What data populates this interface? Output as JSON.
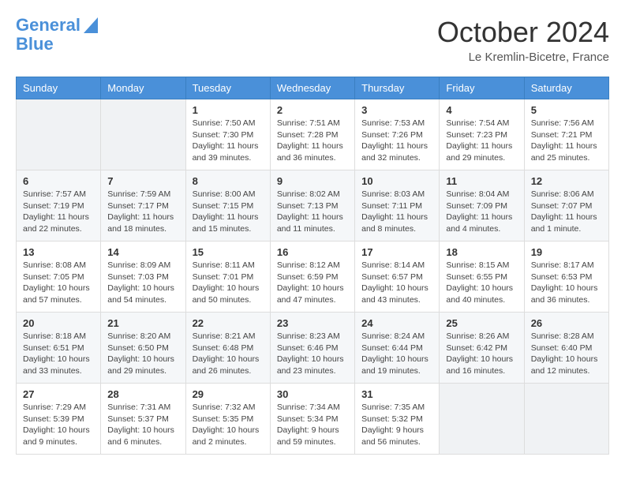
{
  "header": {
    "logo_line1": "General",
    "logo_line2": "Blue",
    "month_year": "October 2024",
    "location": "Le Kremlin-Bicetre, France"
  },
  "days_of_week": [
    "Sunday",
    "Monday",
    "Tuesday",
    "Wednesday",
    "Thursday",
    "Friday",
    "Saturday"
  ],
  "weeks": [
    [
      {
        "day": "",
        "info": ""
      },
      {
        "day": "",
        "info": ""
      },
      {
        "day": "1",
        "info": "Sunrise: 7:50 AM\nSunset: 7:30 PM\nDaylight: 11 hours and 39 minutes."
      },
      {
        "day": "2",
        "info": "Sunrise: 7:51 AM\nSunset: 7:28 PM\nDaylight: 11 hours and 36 minutes."
      },
      {
        "day": "3",
        "info": "Sunrise: 7:53 AM\nSunset: 7:26 PM\nDaylight: 11 hours and 32 minutes."
      },
      {
        "day": "4",
        "info": "Sunrise: 7:54 AM\nSunset: 7:23 PM\nDaylight: 11 hours and 29 minutes."
      },
      {
        "day": "5",
        "info": "Sunrise: 7:56 AM\nSunset: 7:21 PM\nDaylight: 11 hours and 25 minutes."
      }
    ],
    [
      {
        "day": "6",
        "info": "Sunrise: 7:57 AM\nSunset: 7:19 PM\nDaylight: 11 hours and 22 minutes."
      },
      {
        "day": "7",
        "info": "Sunrise: 7:59 AM\nSunset: 7:17 PM\nDaylight: 11 hours and 18 minutes."
      },
      {
        "day": "8",
        "info": "Sunrise: 8:00 AM\nSunset: 7:15 PM\nDaylight: 11 hours and 15 minutes."
      },
      {
        "day": "9",
        "info": "Sunrise: 8:02 AM\nSunset: 7:13 PM\nDaylight: 11 hours and 11 minutes."
      },
      {
        "day": "10",
        "info": "Sunrise: 8:03 AM\nSunset: 7:11 PM\nDaylight: 11 hours and 8 minutes."
      },
      {
        "day": "11",
        "info": "Sunrise: 8:04 AM\nSunset: 7:09 PM\nDaylight: 11 hours and 4 minutes."
      },
      {
        "day": "12",
        "info": "Sunrise: 8:06 AM\nSunset: 7:07 PM\nDaylight: 11 hours and 1 minute."
      }
    ],
    [
      {
        "day": "13",
        "info": "Sunrise: 8:08 AM\nSunset: 7:05 PM\nDaylight: 10 hours and 57 minutes."
      },
      {
        "day": "14",
        "info": "Sunrise: 8:09 AM\nSunset: 7:03 PM\nDaylight: 10 hours and 54 minutes."
      },
      {
        "day": "15",
        "info": "Sunrise: 8:11 AM\nSunset: 7:01 PM\nDaylight: 10 hours and 50 minutes."
      },
      {
        "day": "16",
        "info": "Sunrise: 8:12 AM\nSunset: 6:59 PM\nDaylight: 10 hours and 47 minutes."
      },
      {
        "day": "17",
        "info": "Sunrise: 8:14 AM\nSunset: 6:57 PM\nDaylight: 10 hours and 43 minutes."
      },
      {
        "day": "18",
        "info": "Sunrise: 8:15 AM\nSunset: 6:55 PM\nDaylight: 10 hours and 40 minutes."
      },
      {
        "day": "19",
        "info": "Sunrise: 8:17 AM\nSunset: 6:53 PM\nDaylight: 10 hours and 36 minutes."
      }
    ],
    [
      {
        "day": "20",
        "info": "Sunrise: 8:18 AM\nSunset: 6:51 PM\nDaylight: 10 hours and 33 minutes."
      },
      {
        "day": "21",
        "info": "Sunrise: 8:20 AM\nSunset: 6:50 PM\nDaylight: 10 hours and 29 minutes."
      },
      {
        "day": "22",
        "info": "Sunrise: 8:21 AM\nSunset: 6:48 PM\nDaylight: 10 hours and 26 minutes."
      },
      {
        "day": "23",
        "info": "Sunrise: 8:23 AM\nSunset: 6:46 PM\nDaylight: 10 hours and 23 minutes."
      },
      {
        "day": "24",
        "info": "Sunrise: 8:24 AM\nSunset: 6:44 PM\nDaylight: 10 hours and 19 minutes."
      },
      {
        "day": "25",
        "info": "Sunrise: 8:26 AM\nSunset: 6:42 PM\nDaylight: 10 hours and 16 minutes."
      },
      {
        "day": "26",
        "info": "Sunrise: 8:28 AM\nSunset: 6:40 PM\nDaylight: 10 hours and 12 minutes."
      }
    ],
    [
      {
        "day": "27",
        "info": "Sunrise: 7:29 AM\nSunset: 5:39 PM\nDaylight: 10 hours and 9 minutes."
      },
      {
        "day": "28",
        "info": "Sunrise: 7:31 AM\nSunset: 5:37 PM\nDaylight: 10 hours and 6 minutes."
      },
      {
        "day": "29",
        "info": "Sunrise: 7:32 AM\nSunset: 5:35 PM\nDaylight: 10 hours and 2 minutes."
      },
      {
        "day": "30",
        "info": "Sunrise: 7:34 AM\nSunset: 5:34 PM\nDaylight: 9 hours and 59 minutes."
      },
      {
        "day": "31",
        "info": "Sunrise: 7:35 AM\nSunset: 5:32 PM\nDaylight: 9 hours and 56 minutes."
      },
      {
        "day": "",
        "info": ""
      },
      {
        "day": "",
        "info": ""
      }
    ]
  ]
}
